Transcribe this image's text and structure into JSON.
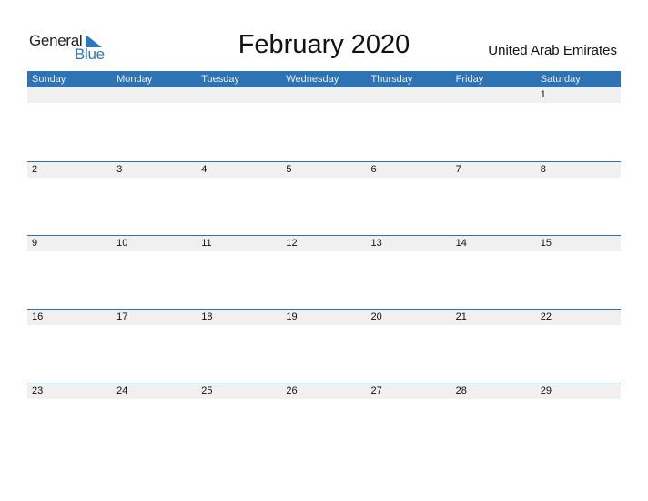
{
  "logo": {
    "general": "General",
    "blue": "Blue"
  },
  "title": "February 2020",
  "country": "United Arab Emirates",
  "weekdays": [
    "Sunday",
    "Monday",
    "Tuesday",
    "Wednesday",
    "Thursday",
    "Friday",
    "Saturday"
  ],
  "weeks": [
    [
      "",
      "",
      "",
      "",
      "",
      "",
      "1"
    ],
    [
      "2",
      "3",
      "4",
      "5",
      "6",
      "7",
      "8"
    ],
    [
      "9",
      "10",
      "11",
      "12",
      "13",
      "14",
      "15"
    ],
    [
      "16",
      "17",
      "18",
      "19",
      "20",
      "21",
      "22"
    ],
    [
      "23",
      "24",
      "25",
      "26",
      "27",
      "28",
      "29"
    ]
  ],
  "colors": {
    "accent": "#2e73b4",
    "logo_blue": "#2a78c0",
    "date_band": "#f0f0f0"
  }
}
